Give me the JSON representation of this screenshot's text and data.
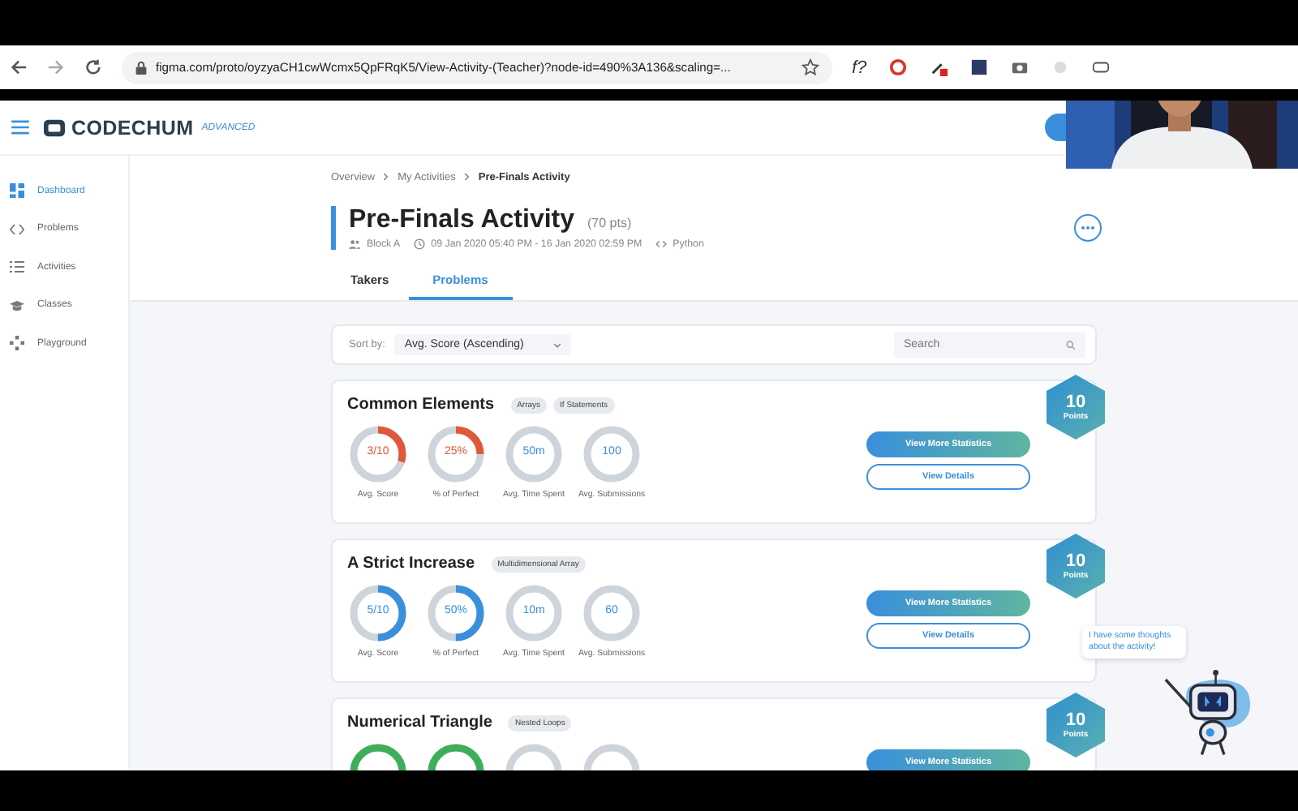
{
  "browser": {
    "url": "figma.com/proto/oyzyaCH1cwWcmx5QpFRqK5/View-Activity-(Teacher)?node-id=490%3A136&scaling=...",
    "extension_text": "f?"
  },
  "app": {
    "logo": "CODECHUM",
    "edition": "ADVANCED"
  },
  "sidebar": {
    "items": [
      {
        "label": "Dashboard",
        "kind": "grid",
        "selected": true
      },
      {
        "label": "Problems",
        "kind": "code",
        "selected": false
      },
      {
        "label": "Activities",
        "kind": "list",
        "selected": false
      },
      {
        "label": "Classes",
        "kind": "cap",
        "selected": false
      },
      {
        "label": "Playground",
        "kind": "pad",
        "selected": false
      }
    ]
  },
  "breadcrumb": [
    "Overview",
    "My Activities",
    "Pre-Finals Activity"
  ],
  "activity": {
    "title": "Pre-Finals Activity",
    "points": "(70 pts)",
    "group": "Block A",
    "schedule": "09 Jan 2020 05:40 PM - 16 Jan 2020 02:59 PM",
    "language": "Python"
  },
  "tabs": [
    {
      "label": "Takers",
      "selected": false
    },
    {
      "label": "Problems",
      "selected": true
    }
  ],
  "toolbar": {
    "sort_label": "Sort by:",
    "sort_value": "Avg. Score (Ascending)",
    "search_placeholder": "Search"
  },
  "problems": [
    {
      "title": "Common Elements",
      "tags": [
        "Arrays",
        "If Statements"
      ],
      "points": "10",
      "points_label": "Points",
      "buttons": [
        "View More Statistics",
        "View Details"
      ],
      "stats": [
        {
          "kind": "gauge",
          "value": "3/10",
          "label": "Avg. Score",
          "color": "#e0583a",
          "level": 0.3
        },
        {
          "kind": "gauge",
          "value": "25%",
          "label": "% of Perfect",
          "color": "#e0583a",
          "level": 0.25
        },
        {
          "kind": "gauge",
          "value": "50m",
          "label": "Avg. Time Spent"
        },
        {
          "kind": "gauge",
          "value": "100",
          "label": "Avg. Submissions"
        }
      ]
    },
    {
      "title": "A Strict Increase",
      "tags": [
        "Multidimensional Array"
      ],
      "points": "10",
      "points_label": "Points",
      "buttons": [
        "View More Statistics",
        "View Details"
      ],
      "stats": [
        {
          "kind": "gauge",
          "value": "5/10",
          "label": "Avg. Score",
          "color": "#3a8fdc",
          "level": 0.5
        },
        {
          "kind": "gauge",
          "value": "50%",
          "label": "% of Perfect",
          "color": "#3a8fdc",
          "level": 0.5
        },
        {
          "kind": "gauge",
          "value": "10m",
          "label": "Avg. Time Spent"
        },
        {
          "kind": "gauge",
          "value": "60",
          "label": "Avg. Submissions"
        }
      ]
    },
    {
      "title": "Numerical Triangle",
      "tags": [
        "Nested Loops"
      ],
      "points": "10",
      "points_label": "Points",
      "buttons": [
        "View More Statistics"
      ],
      "stats": [
        {
          "kind": "gauge",
          "color": "#3fae5a"
        },
        {
          "kind": "gauge",
          "color": "#3fae5a"
        },
        {
          "kind": "gauge"
        },
        {
          "kind": "gauge"
        }
      ]
    }
  ],
  "mascot": {
    "speech": "I have some thoughts about the activity!"
  }
}
